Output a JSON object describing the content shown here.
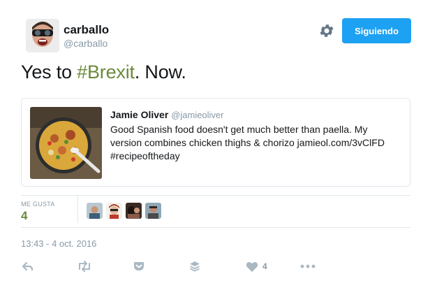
{
  "header": {
    "display_name": "carballo",
    "handle": "@carballo",
    "follow_button_label": "Siguiendo"
  },
  "tweet": {
    "text_before": "Yes to ",
    "hashtag": "#Brexit",
    "text_after": ". Now."
  },
  "quoted_tweet": {
    "author_name": "Jamie Oliver",
    "author_handle": "@jamieoliver",
    "lines": [
      "Good Spanish food doesn't get much better than paella. My",
      "version combines chicken thighs & chorizo jamieol.com/3vClFD",
      "#recipeoftheday"
    ]
  },
  "stats": {
    "likes_label": "ME GUSTA",
    "likes_count": "4"
  },
  "timestamp": "13:43 - 4 oct. 2016",
  "actions": {
    "like_count": "4"
  },
  "colors": {
    "accent_blue": "#1da1f2",
    "hashtag_green": "#6a8a3c",
    "muted_gray": "#8899a6",
    "border": "#e1e8ed"
  },
  "icons": [
    "gear-icon",
    "reply-icon",
    "retweet-icon",
    "pocket-icon",
    "buffer-icon",
    "heart-icon",
    "more-icon"
  ]
}
